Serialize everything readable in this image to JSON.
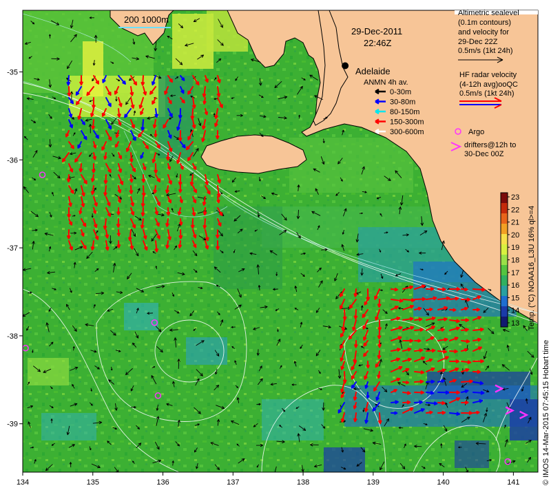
{
  "map": {
    "date_line1": "29-Dec-2011",
    "date_line2": "22:46Z",
    "city": "Adelaide",
    "scale_bar_label": "200  1000m",
    "x_ticks": [
      "134",
      "135",
      "136",
      "137",
      "138",
      "139",
      "140",
      "141"
    ],
    "y_ticks": [
      "-35",
      "-36",
      "-37",
      "-38",
      "-39"
    ],
    "x_range": [
      134,
      141.35
    ],
    "y_range": [
      -39.55,
      -34.3
    ],
    "land_color": "#f7c597",
    "sea_color": "#3cb033"
  },
  "altimetry_legend": {
    "lines": [
      "Altimetric sealevel",
      "(0.1m contours)",
      "and velocity for",
      "29-Dec 22Z",
      "0.5m/s (1kt 24h)"
    ]
  },
  "radar_legend": {
    "lines": [
      "HF radar velocity",
      "(4-12h avg)ooQC",
      "0.5m/s (1kt 24h)"
    ],
    "arrow_colors": [
      "#ff0000",
      "#0000ff"
    ]
  },
  "anmn_legend": {
    "title": "ANMN 4h av.",
    "items": [
      {
        "label": "0-30m",
        "color": "#000000"
      },
      {
        "label": "30-80m",
        "color": "#0000ff"
      },
      {
        "label": "80-150m",
        "color": "#00e5ee"
      },
      {
        "label": "150-300m",
        "color": "#ff0000"
      },
      {
        "label": "300-600m",
        "color": "#ffffff"
      }
    ]
  },
  "argo_legend": {
    "argo_label": "Argo",
    "drifter_lines": [
      "drifters@12h to",
      "30-Dec 00Z"
    ],
    "color": "#ff33ff"
  },
  "colorbar": {
    "label": "Temp. (°C) NOAA16_L3U 16% ql>=4",
    "ticks": [
      "23",
      "22",
      "21",
      "20",
      "19",
      "18",
      "17",
      "16",
      "15",
      "14",
      "13"
    ],
    "colors": [
      "#7a0a0a",
      "#c42a0a",
      "#e8641a",
      "#f2a024",
      "#f7e04a",
      "#d8f040",
      "#9ae048",
      "#54c440",
      "#30b060",
      "#2aa0a0",
      "#1e6ed0",
      "#1a3aa8",
      "#121a70"
    ]
  },
  "footer": {
    "credit": "© IMOS 14-Mar-2015 07:45:15 Hobart time"
  },
  "chart_data": {
    "type": "map",
    "xlim": [
      134,
      141.35
    ],
    "ylim": [
      -39.55,
      -34.3
    ],
    "markers": [
      {
        "kind": "city",
        "label": "Adelaide",
        "lon": 138.6,
        "lat": -34.93
      }
    ],
    "argo_floats": [
      {
        "lon": 134.28,
        "lat": -36.17
      },
      {
        "lon": 134.04,
        "lat": -38.14
      },
      {
        "lon": 135.88,
        "lat": -37.85
      },
      {
        "lon": 135.93,
        "lat": -38.68
      },
      {
        "lon": 140.92,
        "lat": -39.43
      }
    ],
    "drifters": [
      {
        "lon": 140.8,
        "lat": -38.6
      },
      {
        "lon": 140.95,
        "lat": -38.85
      },
      {
        "lon": 141.15,
        "lat": -38.9
      }
    ]
  }
}
